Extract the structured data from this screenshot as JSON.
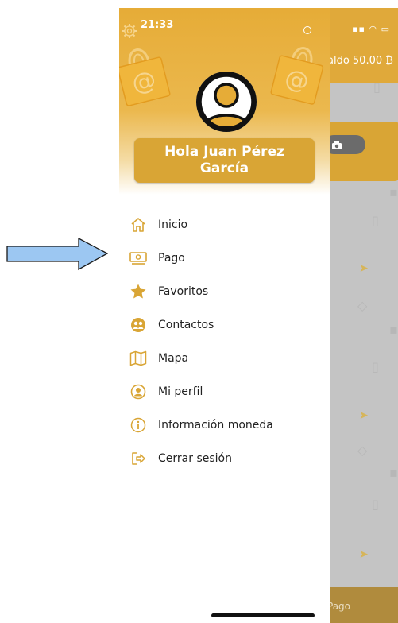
{
  "status": {
    "time": "21:33"
  },
  "background_app": {
    "saldo": "aldo 50.00 ₿",
    "footer_label": "Pago"
  },
  "drawer": {
    "greeting": "Hola Juan Pérez García",
    "menu": [
      {
        "label": "Inicio",
        "icon": "home-icon"
      },
      {
        "label": "Pago",
        "icon": "money-icon"
      },
      {
        "label": "Favoritos",
        "icon": "star-icon"
      },
      {
        "label": "Contactos",
        "icon": "contacts-icon"
      },
      {
        "label": "Mapa",
        "icon": "map-icon"
      },
      {
        "label": "Mi perfil",
        "icon": "profile-icon"
      },
      {
        "label": "Información moneda",
        "icon": "info-icon"
      },
      {
        "label": "Cerrar sesión",
        "icon": "logout-icon"
      }
    ]
  },
  "colors": {
    "accent": "#e6ac37",
    "accent_dark": "#d9a535",
    "annotation_arrow": "#9cc7f2"
  }
}
